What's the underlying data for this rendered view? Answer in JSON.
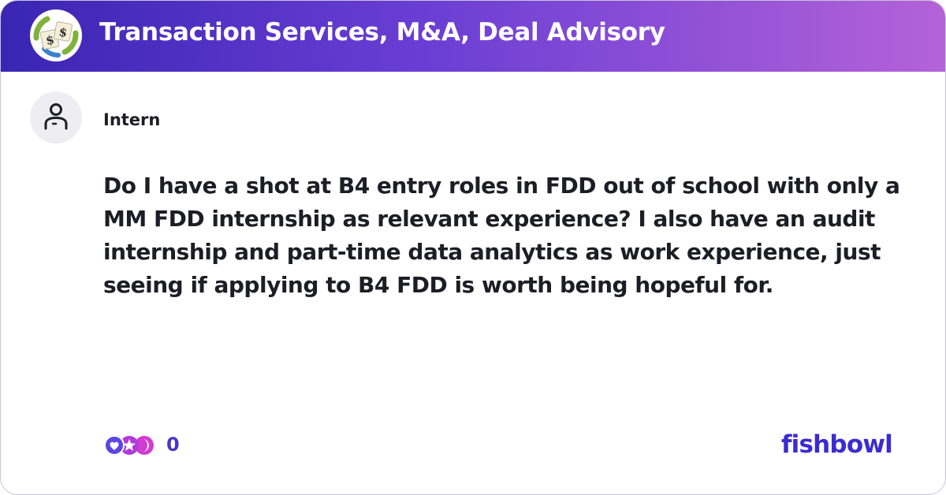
{
  "header": {
    "title": "Transaction Services, M&A, Deal Advisory",
    "bowl_icon": "money-bowl-icon",
    "gradient_start": "#3a25b3",
    "gradient_end": "#b462d8"
  },
  "post": {
    "author": "Intern",
    "avatar_icon": "person-icon",
    "text": "Do I have a shot at B4 entry roles in FDD out of school with only a MM FDD internship as relevant experience? I also have an audit internship and part-time data analytics as work experience, just seeing if applying to B4 FDD is worth being hopeful for."
  },
  "footer": {
    "reaction_count": "0",
    "reaction_icons": [
      "heart-icon",
      "star-icon",
      "moon-icon"
    ],
    "brand": "fishbowl",
    "brand_color": "#3b2bd0"
  }
}
